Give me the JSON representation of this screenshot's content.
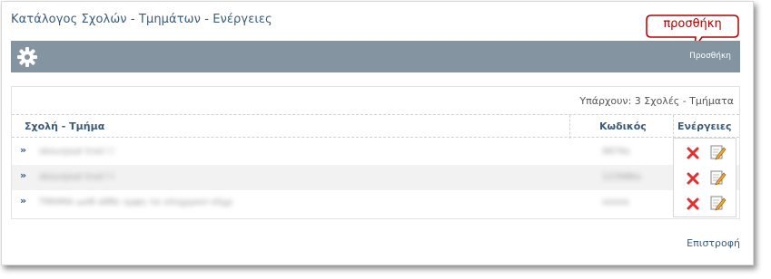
{
  "page": {
    "title": "Κατάλογος Σχολών - Τμημάτων - Ενέργειες"
  },
  "toolbar": {
    "settings_icon": "gear-icon",
    "add_label": "Προσθήκη"
  },
  "callout": {
    "text": "προσθήκη",
    "border_color": "#b00000"
  },
  "summary": {
    "count_text": "Υπάρχουν: 3 Σχολές - Τμήματα"
  },
  "table": {
    "columns": [
      "Σχολή - Τμήμα",
      "Κωδικός",
      "Ενέργειες"
    ],
    "rows": [
      {
        "name": "skourpsal trsd l l",
        "code": "9876s"
      },
      {
        "name": "skourpsal trsd l l",
        "code": "12398ks"
      },
      {
        "name": "ΤΜΗΜΑ ωσθ αθθε ορφη τα ολοχρρκσ οδχρ",
        "code": "oooos"
      }
    ],
    "row_arrow": "»",
    "delete_icon": "delete-x-icon",
    "edit_icon": "edit-pencil-icon"
  },
  "footer": {
    "back_label": "Επιστροφή"
  },
  "colors": {
    "toolbar_bg": "#8494a1",
    "text_link": "#3a5b7a",
    "callout_red": "#b00000"
  }
}
